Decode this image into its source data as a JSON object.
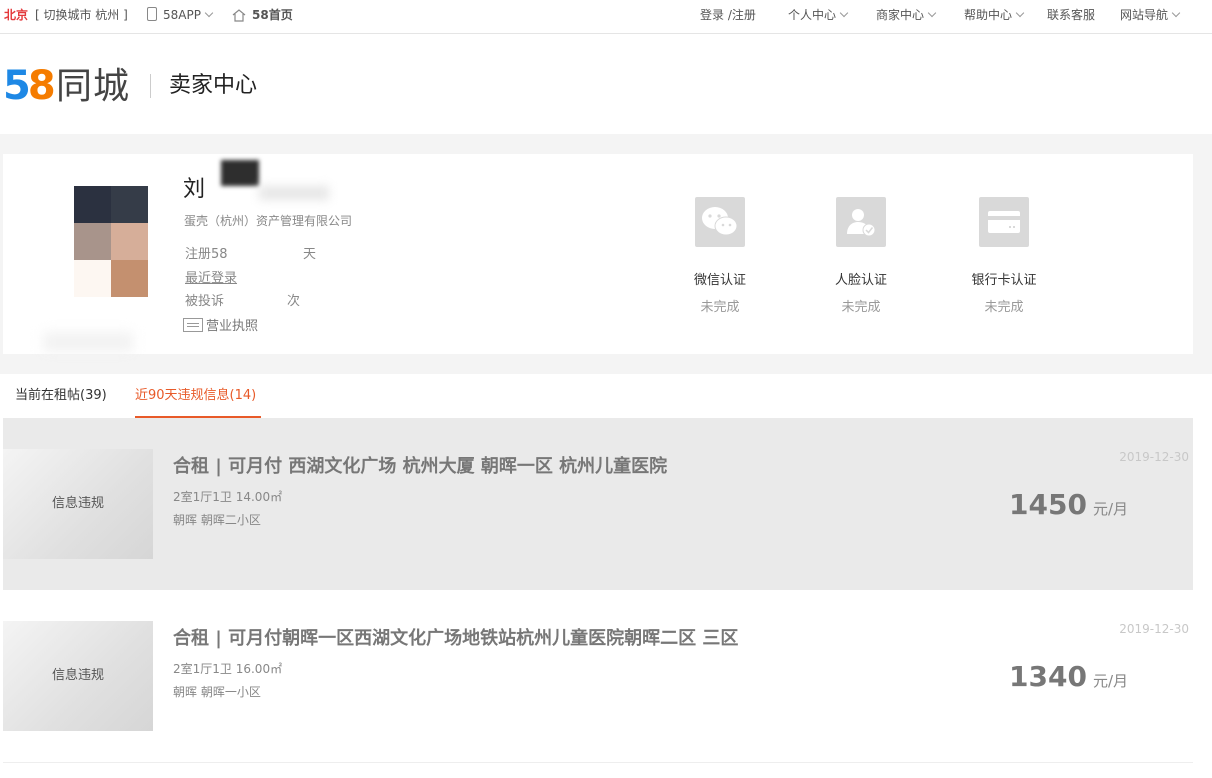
{
  "topbar": {
    "city": "北京",
    "switch_city": "[ 切换城市  杭州 ]",
    "app": "58APP",
    "home": "58首页",
    "login": "登录 /注册",
    "personal": "个人中心",
    "merchant": "商家中心",
    "help": "帮助中心",
    "contact": "联系客服",
    "sitenav": "网站导航"
  },
  "header": {
    "logo_num_5": "5",
    "logo_num_8": "8",
    "logo_text": "同城",
    "section": "卖家中心"
  },
  "profile": {
    "name": "刘",
    "company": "蛋壳（杭州）资产管理有限公司",
    "reg_label": "注册58",
    "reg_value": "天",
    "login_label": "最近登录",
    "login_value": "",
    "complaint_label": "被投诉",
    "complaint_value": "次",
    "license": "营业执照",
    "avatar_colors": [
      "#2b3140",
      "#353c48",
      "#a8948b",
      "#d6ae99",
      "#fdf7f2",
      "#c4906f"
    ]
  },
  "auth": [
    {
      "title": "微信认证",
      "status": "未完成",
      "icon": "wechat-icon"
    },
    {
      "title": "人脸认证",
      "status": "未完成",
      "icon": "face-verify-icon"
    },
    {
      "title": "银行卡认证",
      "status": "未完成",
      "icon": "bank-card-icon"
    }
  ],
  "tabs": [
    {
      "label": "当前在租帖(39)",
      "active": false
    },
    {
      "label": "近90天违规信息(14)",
      "active": true
    }
  ],
  "listings": [
    {
      "thumb_label": "信息违规",
      "title": "合租 | 可月付 西湖文化广场 杭州大厦 朝晖一区 杭州儿童医院",
      "spec": "2室1厅1卫 14.00㎡",
      "area": "朝晖 朝晖二小区",
      "date": "2019-12-30",
      "price": "1450",
      "unit": "元/月"
    },
    {
      "thumb_label": "信息违规",
      "title": "合租 | 可月付朝晖一区西湖文化广场地铁站杭州儿童医院朝晖二区 三区",
      "spec": "2室1厅1卫 16.00㎡",
      "area": "朝晖 朝晖一小区",
      "date": "2019-12-30",
      "price": "1340",
      "unit": "元/月"
    }
  ],
  "colors": {
    "accent": "#e85a29",
    "city": "#e4393c"
  }
}
